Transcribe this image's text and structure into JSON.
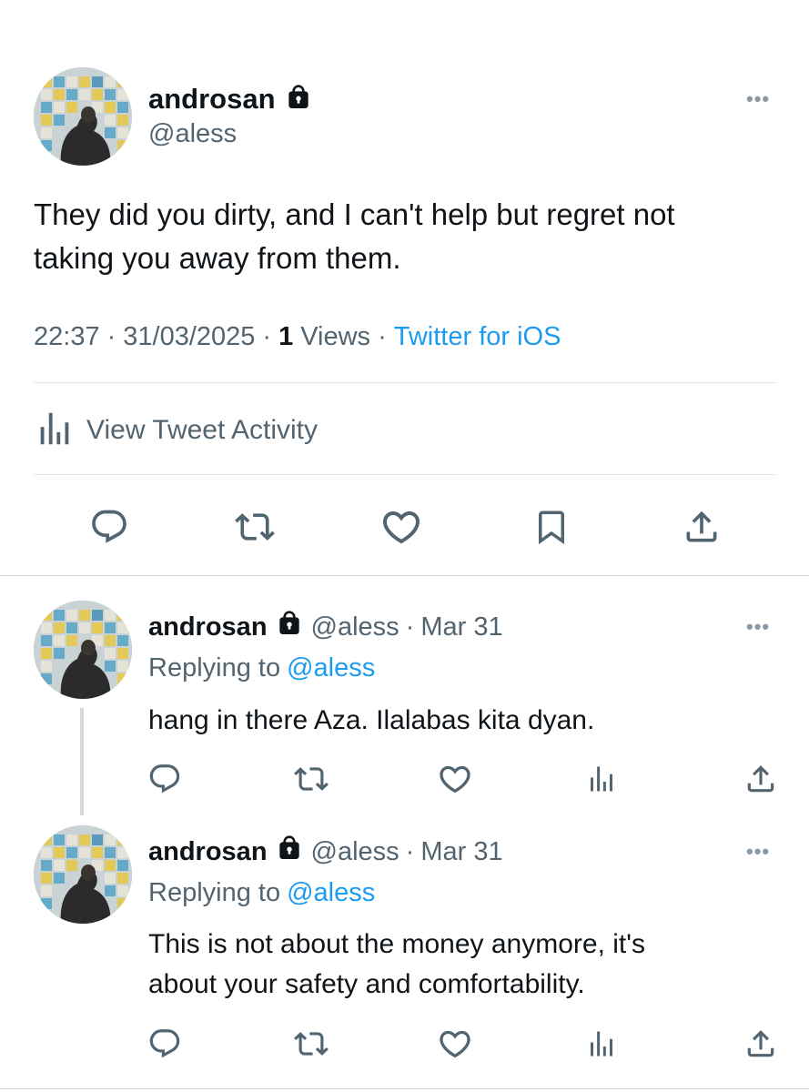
{
  "colors": {
    "accent": "#1d9bf0",
    "text": "#0f1419",
    "secondary": "#536471",
    "divider": "#e1e4e8"
  },
  "main_tweet": {
    "display_name": "androsan",
    "handle": "@aless",
    "text_line1": "They did you dirty, and I can't help but regret not",
    "text_line2": "taking you away from them.",
    "time": "22:37",
    "date": "31/03/2025",
    "views_count": "1",
    "views_label": "Views",
    "source": "Twitter for iOS",
    "activity_label": "View Tweet Activity",
    "lock_icon": "lock-icon",
    "more_icon": "more-icon"
  },
  "replies": [
    {
      "display_name": "androsan",
      "handle": "@aless",
      "date": "Mar 31",
      "replying_prefix": "Replying to",
      "replying_handle": "@aless",
      "text_line1": "hang in there Aza. Ilalabas kita dyan.",
      "text_line2": ""
    },
    {
      "display_name": "androsan",
      "handle": "@aless",
      "date": "Mar 31",
      "replying_prefix": "Replying to",
      "replying_handle": "@aless",
      "text_line1": "This is not about the money anymore, it's",
      "text_line2": "about your safety and comfortability."
    }
  ],
  "separators": {
    "dot": "·"
  }
}
